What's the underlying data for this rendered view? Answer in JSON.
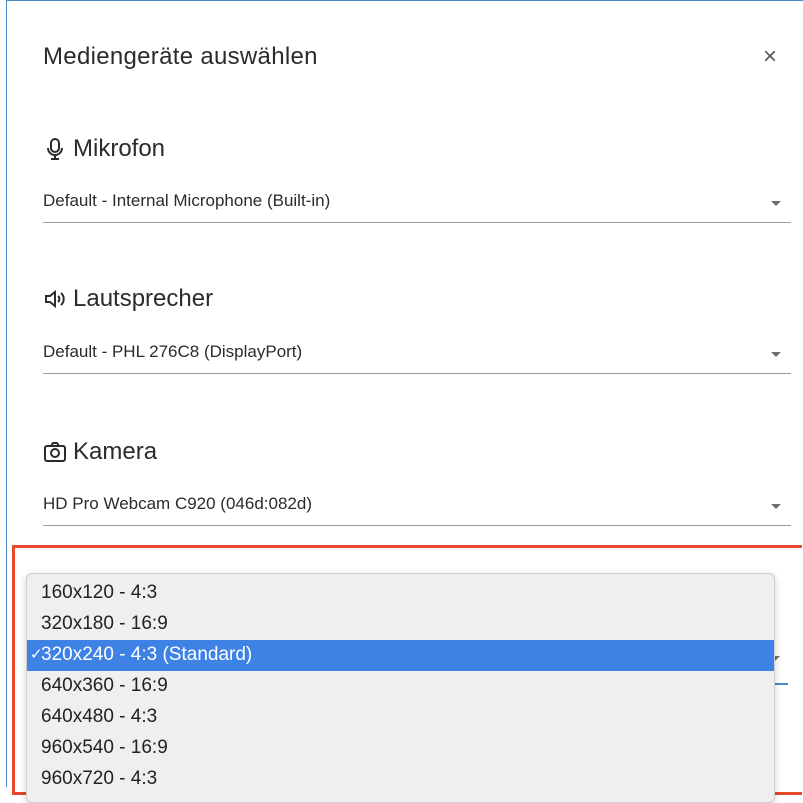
{
  "dialog": {
    "title": "Mediengeräte auswählen",
    "close_glyph": "×"
  },
  "microphone": {
    "icon": "microphone-icon",
    "label": "Mikrofon",
    "value": "Default - Internal Microphone (Built-in)"
  },
  "speaker": {
    "icon": "speaker-icon",
    "label": "Lautsprecher",
    "value": "Default - PHL 276C8 (DisplayPort)"
  },
  "camera": {
    "icon": "camera-icon",
    "label": "Kamera",
    "value": "HD Pro Webcam C920 (046d:082d)"
  },
  "resolution": {
    "options": [
      "160x120 - 4:3",
      "320x180 - 16:9",
      "320x240 - 4:3 (Standard)",
      "640x360 - 16:9",
      "640x480 - 4:3",
      "960x540 - 16:9",
      "960x720 - 4:3"
    ],
    "selected_index": 2,
    "check_glyph": "✓"
  },
  "colors": {
    "accent": "#3e82e5",
    "highlight": "#e8472a",
    "border": "#4a88c7"
  }
}
